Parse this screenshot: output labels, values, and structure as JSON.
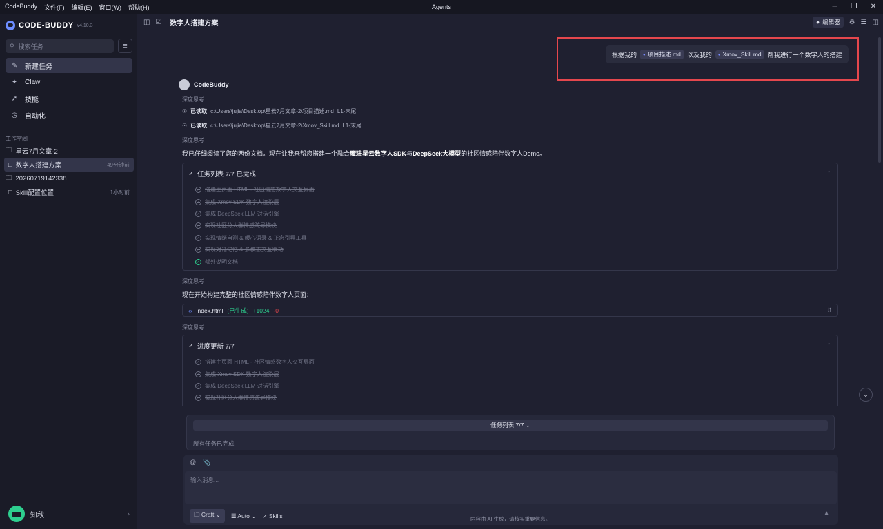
{
  "titlebar": {
    "app": "CodeBuddy",
    "menus": [
      "文件(F)",
      "编辑(E)",
      "窗口(W)",
      "帮助(H)"
    ],
    "center_title": "Agents"
  },
  "sidebar": {
    "logo": "CODE-BUDDY",
    "version": "v4.10.3",
    "search_placeholder": "搜索任务",
    "nav": [
      {
        "label": "新建任务",
        "icon": "edit-square-icon"
      },
      {
        "label": "Claw",
        "icon": "claw-icon"
      },
      {
        "label": "技能",
        "icon": "skills-icon"
      },
      {
        "label": "自动化",
        "icon": "clock-icon"
      }
    ],
    "workspace_title": "工作空间",
    "tree": [
      {
        "label": "星云7月文章-2",
        "type": "folder",
        "time": ""
      },
      {
        "label": "数字人搭建方案",
        "type": "chat",
        "time": "49分钟前"
      },
      {
        "label": "20260719142338",
        "type": "folder",
        "time": ""
      },
      {
        "label": "Skill配置位置",
        "type": "chat",
        "time": "1小时前"
      }
    ],
    "user_name": "知秋"
  },
  "topbar": {
    "title": "数字人搭建方案",
    "editor_label": "编辑器"
  },
  "conversation": {
    "user_message": {
      "p1": "根据我的",
      "file1": "项目描述.md",
      "p2": "以及我的",
      "file2": "Xmov_Skill.md",
      "p3": "帮我进行一个数字人的搭建"
    },
    "bot_name": "CodeBuddy",
    "thinking_label": "深度思考",
    "read_label": "已读取",
    "reads": [
      {
        "path": "c:\\Users\\jujia\\Desktop\\星云7月文章-2\\项目描述.md",
        "range": "L1-末尾"
      },
      {
        "path": "c:\\Users\\jujia\\Desktop\\星云7月文章-2\\Xmov_Skill.md",
        "range": "L1-末尾"
      }
    ],
    "intro": {
      "a": "我已仔细阅读了您的两份文档。现在让我来帮您搭建一个融合",
      "b": "魔珐星云数字人SDK",
      "c": "与",
      "d": "DeepSeek大模型",
      "e": "的社区情感陪伴数字人Demo。"
    },
    "task_card_title": "任务列表 7/7 已完成",
    "tasks": [
      "搭建主页面 HTML - 社区情感数字人交互界面",
      "集成 Xmov SDK 数字人渲染层",
      "集成 DeepSeek LLM 对话引擎",
      "实现社区分人群情感疏导模块",
      "实现情绪自测 & 暖心语录 & 正念引导工具",
      "实现对话记忆 & 多模态交互联动",
      "额外说明文档"
    ],
    "build_text": "现在开始构建完整的社区情感陪伴数字人页面：",
    "file": {
      "name": "index.html",
      "status": "(已生成)",
      "added": "+1024",
      "removed": "-0"
    },
    "progress_title": "进度更新 7/7",
    "progress_tasks": [
      "搭建主页面 HTML - 社区情感数字人交互界面",
      "集成 Xmov SDK 数字人渲染层",
      "集成 DeepSeek LLM 对话引擎",
      "实现社区分人群情感疏导模块"
    ]
  },
  "task_panel": {
    "bar_label": "任务列表 7/7",
    "done_label": "所有任务已完成"
  },
  "composer": {
    "placeholder": "输入消息...",
    "mode": "Craft",
    "model": "Auto",
    "skills": "Skills"
  },
  "footer": "内容由 AI 生成，请核实重要信息。"
}
